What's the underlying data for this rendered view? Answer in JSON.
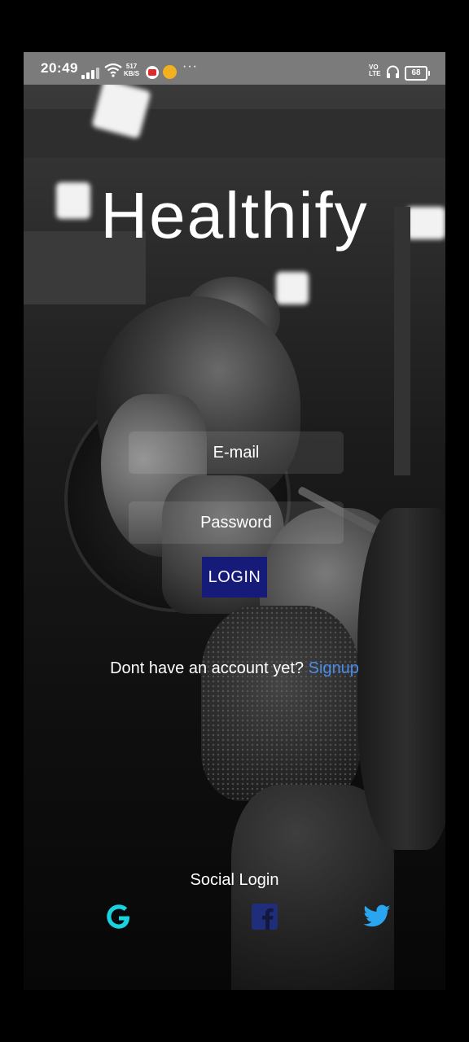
{
  "status_bar": {
    "time": "20:49",
    "net_speed_value": "517",
    "net_speed_unit": "KB/S",
    "more": "···",
    "volte_top": "VO",
    "volte_bottom": "LTE",
    "battery": "68"
  },
  "app": {
    "title": "Healthify"
  },
  "login_form": {
    "email_placeholder": "E-mail",
    "password_placeholder": "Password",
    "login_button": "LOGIN"
  },
  "signup": {
    "prompt": "Dont have an account yet?",
    "link": "Signup"
  },
  "social": {
    "title": "Social Login",
    "items": [
      {
        "name": "google",
        "icon": "google-icon",
        "color": "#19d3e0"
      },
      {
        "name": "facebook",
        "icon": "facebook-icon",
        "color": "#1f2d7a"
      },
      {
        "name": "twitter",
        "icon": "twitter-icon",
        "color": "#2aa6f0"
      }
    ]
  },
  "colors": {
    "accent_button": "#161a79",
    "link": "#4a8de8",
    "status_bar": "#7b7b7b"
  }
}
